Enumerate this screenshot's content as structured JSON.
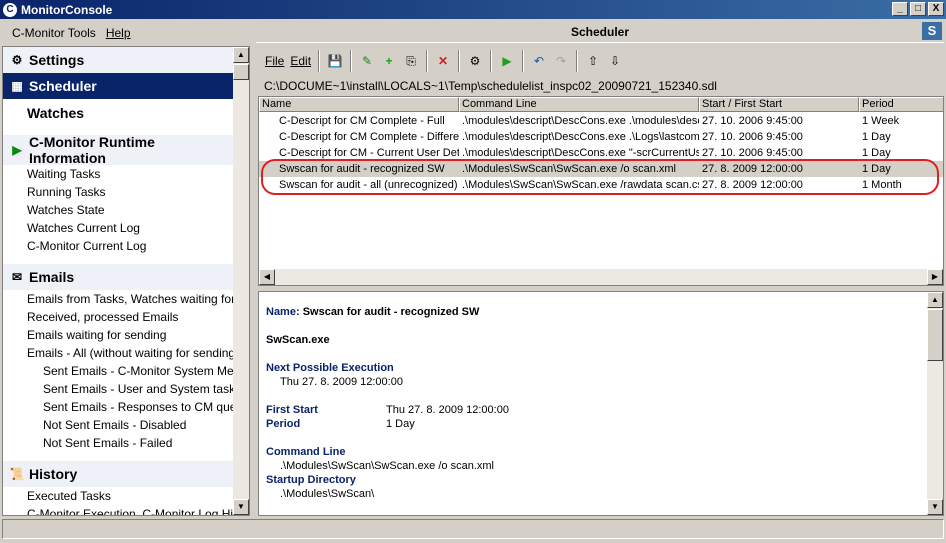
{
  "window": {
    "title": "MonitorConsole",
    "buttons": [
      "_",
      "□",
      "X"
    ]
  },
  "menubar": {
    "items": [
      "C-Monitor Tools",
      "Help"
    ]
  },
  "left": {
    "settings": "Settings",
    "scheduler": "Scheduler",
    "watches": "Watches",
    "runtime": "C-Monitor Runtime Information",
    "runtime_items": [
      "Waiting Tasks",
      "Running Tasks",
      "Watches State",
      "Watches Current Log",
      "C-Monitor Current Log"
    ],
    "emails": "Emails",
    "email_items": [
      "Emails from Tasks, Watches waiting for sending",
      "Received, processed Emails",
      "Emails waiting for sending",
      "Emails - All (without waiting for sending)"
    ],
    "email_sub_items": [
      "Sent Emails - C-Monitor System Messages",
      "Sent Emails - User and System tasks Results",
      "Sent Emails - Responses to CM queries",
      "Not Sent Emails - Disabled",
      "Not Sent Emails - Failed"
    ],
    "history": "History",
    "history_items": [
      "Executed Tasks",
      "C-Monitor Execution, C-Monitor Log History"
    ]
  },
  "right": {
    "header": "Scheduler",
    "toolbar": {
      "file": "File",
      "edit": "Edit"
    },
    "path": "C:\\DOCUME~1\\install\\LOCALS~1\\Temp\\schedulelist_inspc02_20090721_152340.sdl",
    "columns": [
      "Name",
      "Command Line",
      "Start / First Start",
      "Period"
    ],
    "rows": [
      [
        "C-Descript for CM Complete - Full",
        ".\\modules\\descript\\DescCons.exe .\\modules\\descript",
        "27. 10. 2006 9:45:00",
        "1 Week"
      ],
      [
        "C-Descript for CM Complete - Differential",
        ".\\modules\\descript\\DescCons.exe .\\Logs\\lastcomplete",
        "27. 10. 2006 9:45:00",
        "1 Day"
      ],
      [
        "C-Descript for CM - Current User Details",
        ".\\modules\\descript\\DescCons.exe \"-scrCurrentUser",
        "27. 10. 2006 9:45:00",
        "1 Day"
      ],
      [
        "Swscan for audit - recognized SW",
        ".\\Modules\\SwScan\\SwScan.exe /o scan.xml",
        "27. 8. 2009 12:00:00",
        "1 Day"
      ],
      [
        "Swscan for audit - all (unrecognized) SW",
        ".\\Modules\\SwScan\\SwScan.exe /rawdata scan.csv",
        "27. 8. 2009 12:00:00",
        "1 Month"
      ]
    ],
    "detail": {
      "name_label": "Name:",
      "name_value": "Swscan for audit - recognized SW",
      "exe": "SwScan.exe",
      "next_label": "Next Possible Execution",
      "next_value": "Thu 27. 8. 2009 12:00:00",
      "first_label": "First Start",
      "first_value": "Thu 27. 8. 2009 12:00:00",
      "period_label": "Period",
      "period_value": "1 Day",
      "cmd_label": "Command Line",
      "cmd_value": ".\\Modules\\SwScan\\SwScan.exe /o scan.xml",
      "dir_label": "Startup Directory",
      "dir_value": ".\\Modules\\SwScan\\"
    }
  },
  "colors": {
    "selection": "#0a246a",
    "highlight_ring": "#e02020",
    "detail_label": "#0a246a"
  }
}
